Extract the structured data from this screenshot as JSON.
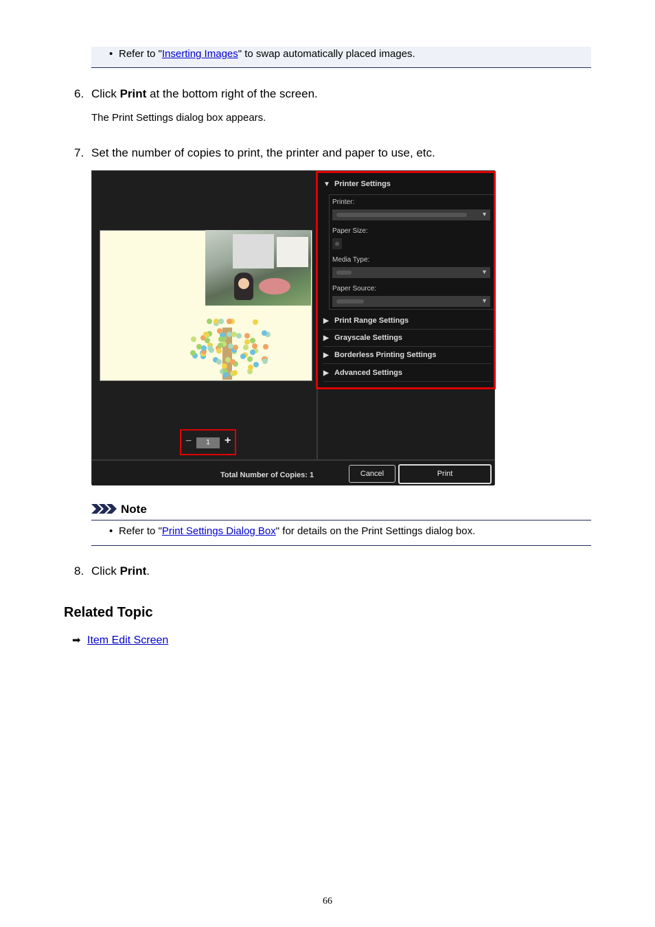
{
  "top_note": {
    "text_before": "Refer to \"",
    "link": "Inserting Images",
    "text_after": "\" to swap automatically placed images."
  },
  "step6": {
    "number": "6.",
    "text_before": "Click ",
    "bold": "Print",
    "text_after": " at the bottom right of the screen.",
    "sub": "The Print Settings dialog box appears."
  },
  "step7": {
    "number": "7.",
    "text": "Set the number of copies to print, the printer and paper to use, etc."
  },
  "dialog": {
    "sections": {
      "printer_settings": "Printer Settings",
      "print_range": "Print Range Settings",
      "grayscale": "Grayscale Settings",
      "borderless": "Borderless Printing Settings",
      "advanced": "Advanced Settings"
    },
    "fields": {
      "printer": "Printer:",
      "paper_size": "Paper Size:",
      "media_type": "Media Type:",
      "paper_source": "Paper Source:"
    },
    "copies": {
      "minus": "−",
      "value": "1",
      "plus": "+"
    },
    "total_label": "Total Number of Copies:",
    "total_value": "1",
    "cancel": "Cancel",
    "print": "Print",
    "colors": {
      "highlight": "#e00000",
      "background": "#1c1c1c"
    }
  },
  "note": {
    "heading": "Note",
    "text_before": "Refer to \"",
    "link": "Print Settings Dialog Box",
    "text_after": "\" for details on the Print Settings dialog box."
  },
  "step8": {
    "number": "8.",
    "text_before": "Click ",
    "bold": "Print",
    "text_after": "."
  },
  "related": {
    "heading": "Related Topic",
    "link": "Item Edit Screen"
  },
  "page_number": "66"
}
